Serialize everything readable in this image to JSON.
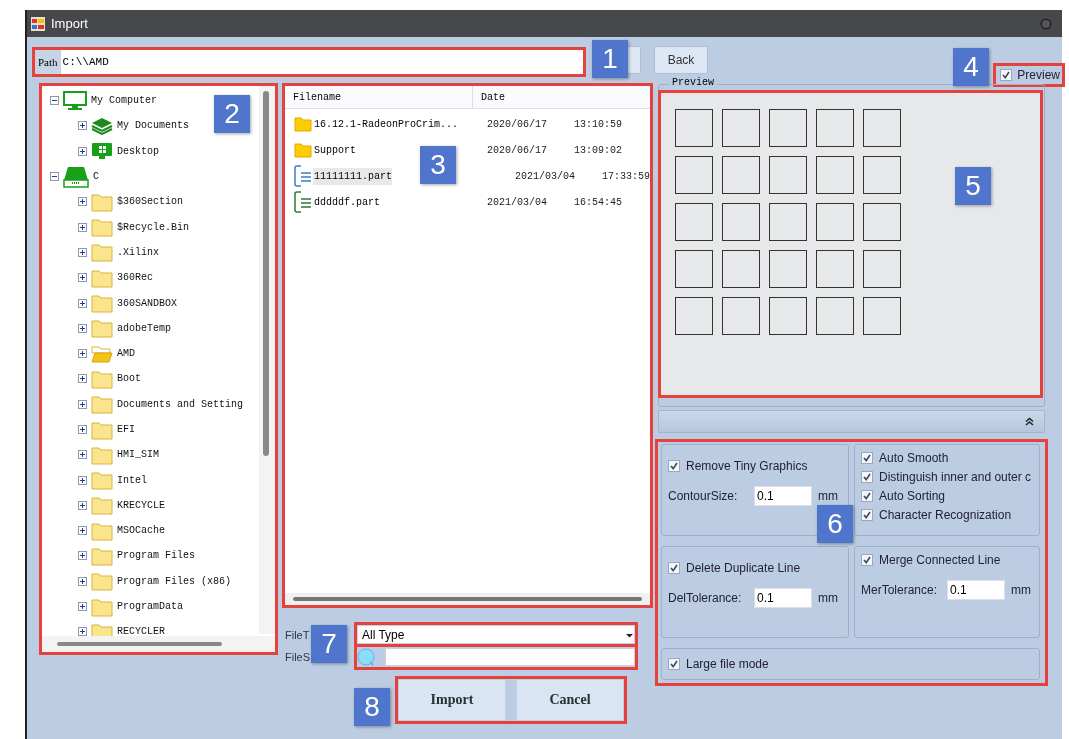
{
  "window": {
    "title": "Import"
  },
  "path_bar": {
    "label": "Path",
    "value": "C:\\\\AMD",
    "back_button": "Back"
  },
  "preview_toggle": {
    "label": "Preview",
    "checked": true
  },
  "folder_tree": [
    {
      "label": "My Computer",
      "kind": "computer",
      "expanded": true,
      "children": [
        {
          "label": "My Documents",
          "kind": "documents",
          "expanded": false
        },
        {
          "label": "Desktop",
          "kind": "desktop",
          "expanded": false
        }
      ]
    },
    {
      "label": "C",
      "kind": "drive",
      "expanded": true,
      "children": [
        {
          "label": "$360Section",
          "kind": "folder",
          "expanded": false
        },
        {
          "label": "$Recycle.Bin",
          "kind": "folder",
          "expanded": false
        },
        {
          "label": ".Xilinx",
          "kind": "folder",
          "expanded": false
        },
        {
          "label": "360Rec",
          "kind": "folder",
          "expanded": false
        },
        {
          "label": "360SANDBOX",
          "kind": "folder",
          "expanded": false
        },
        {
          "label": "adobeTemp",
          "kind": "folder",
          "expanded": false
        },
        {
          "label": "AMD",
          "kind": "open-folder",
          "expanded": false
        },
        {
          "label": "Boot",
          "kind": "folder",
          "expanded": false
        },
        {
          "label": "Documents and Setting",
          "kind": "folder",
          "expanded": false
        },
        {
          "label": "EFI",
          "kind": "folder",
          "expanded": false
        },
        {
          "label": "HMI_SIM",
          "kind": "folder",
          "expanded": false
        },
        {
          "label": "Intel",
          "kind": "folder",
          "expanded": false
        },
        {
          "label": "KRECYCLE",
          "kind": "folder",
          "expanded": false
        },
        {
          "label": "MSOCache",
          "kind": "folder",
          "expanded": false
        },
        {
          "label": "Program Files",
          "kind": "folder",
          "expanded": false
        },
        {
          "label": "Program Files (x86)",
          "kind": "folder",
          "expanded": false
        },
        {
          "label": "ProgramData",
          "kind": "folder",
          "expanded": false
        },
        {
          "label": "RECYCLER",
          "kind": "folder",
          "expanded": false
        }
      ]
    }
  ],
  "file_list": {
    "columns": [
      "Filename",
      "Date"
    ],
    "rows": [
      {
        "name": "16.12.1-RadeonProCrim...",
        "kind": "folder",
        "date": "2020/06/17",
        "time": "13:10:59",
        "selected": false
      },
      {
        "name": "Support",
        "kind": "folder",
        "date": "2020/06/17",
        "time": "13:09:02",
        "selected": false
      },
      {
        "name": "11111111.part",
        "kind": "file",
        "date": "2021/03/04",
        "time": "17:33:59",
        "selected": true
      },
      {
        "name": "dddddf.part",
        "kind": "file",
        "date": "2021/03/04",
        "time": "16:54:45",
        "selected": false
      }
    ]
  },
  "preview": {
    "title": "Preview"
  },
  "options": [
    {
      "items": [
        {
          "kind": "checkbox",
          "label": "Remove Tiny Graphics",
          "checked": true
        },
        {
          "kind": "field",
          "label": "ContourSize:",
          "value": "0.1",
          "unit": "mm"
        }
      ]
    },
    {
      "items": [
        {
          "kind": "checkbox",
          "label": "Auto Smooth",
          "checked": true
        },
        {
          "kind": "checkbox",
          "label": "Distinguish inner and outer c",
          "checked": true
        },
        {
          "kind": "checkbox",
          "label": "Auto Sorting",
          "checked": true
        },
        {
          "kind": "checkbox",
          "label": "Character Recognization",
          "checked": true
        }
      ]
    },
    {
      "items": [
        {
          "kind": "checkbox",
          "label": "Delete Duplicate Line",
          "checked": true
        },
        {
          "kind": "field",
          "label": "DelTolerance:",
          "value": "0.1",
          "unit": "mm"
        }
      ]
    },
    {
      "items": [
        {
          "kind": "checkbox",
          "label": "Merge Connected Line",
          "checked": true
        },
        {
          "kind": "field",
          "label": "MerTolerance:",
          "value": "0.1",
          "unit": "mm"
        }
      ]
    },
    {
      "items": [
        {
          "kind": "checkbox",
          "label": "Large file mode",
          "checked": true
        }
      ]
    }
  ],
  "filter": {
    "type_label": "FileT",
    "type_value": "All Type",
    "search_label": "FileS"
  },
  "buttons": [
    "Import",
    "Cancel"
  ],
  "annotations": [
    {
      "label": "1"
    },
    {
      "label": "2"
    },
    {
      "label": "3"
    },
    {
      "label": "4"
    },
    {
      "label": "5"
    },
    {
      "label": "6"
    },
    {
      "label": "7"
    },
    {
      "label": "8"
    }
  ]
}
